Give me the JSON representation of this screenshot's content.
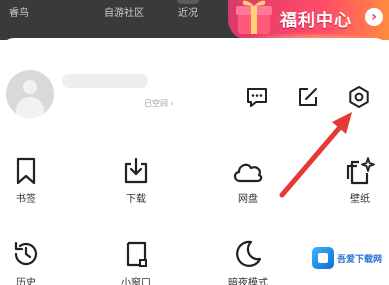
{
  "top_tabs": [
    "睿鸟",
    "自游社区",
    "近况"
  ],
  "welfare_banner": {
    "label": "福利中心"
  },
  "profile": {
    "link_text": "已空间 ›"
  },
  "grid": [
    {
      "label": "书签",
      "icon": "bookmark-icon"
    },
    {
      "label": "下载",
      "icon": "download-icon"
    },
    {
      "label": "网盘",
      "icon": "cloud-icon"
    },
    {
      "label": "壁纸",
      "icon": "wallpaper-icon"
    },
    {
      "label": "历史",
      "icon": "history-icon"
    },
    {
      "label": "小窗口",
      "icon": "window-icon"
    },
    {
      "label": "暗夜模式",
      "icon": "moon-icon"
    }
  ],
  "watermark": {
    "text": "吾爱下载网"
  },
  "colors": {
    "accent_red": "#e53935",
    "welfare_gradient_start": "#d83a6c",
    "welfare_gradient_end": "#ff8a3d",
    "topbar": "#3a3a3c"
  }
}
